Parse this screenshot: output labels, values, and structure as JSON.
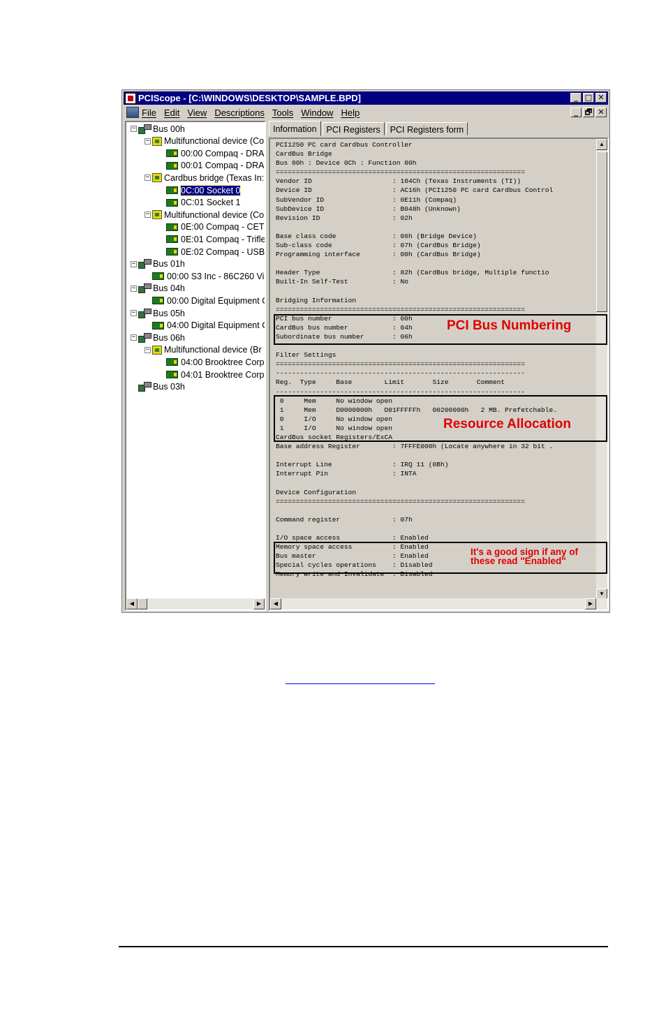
{
  "window": {
    "title": "PCIScope - [C:\\WINDOWS\\DESKTOP\\SAMPLE.BPD]",
    "title_buttons": [
      "_",
      "□",
      "✕"
    ],
    "mdi_buttons": [
      "_",
      "🗗",
      "✕"
    ]
  },
  "menu": {
    "items": [
      "File",
      "Edit",
      "View",
      "Descriptions",
      "Tools",
      "Window",
      "Help"
    ]
  },
  "tree": {
    "items": [
      {
        "label": "Bus 00h",
        "icon": "bus-icon",
        "level": 0
      },
      {
        "label": "Multifunctional device (Co",
        "icon": "multifunction-icon",
        "level": 1
      },
      {
        "label": "00:00 Compaq - DRA",
        "icon": "device-icon",
        "level": 2
      },
      {
        "label": "00:01 Compaq - DRA",
        "icon": "device-icon",
        "level": 2
      },
      {
        "label": "Cardbus bridge (Texas In:",
        "icon": "multifunction-icon",
        "level": 1
      },
      {
        "label": "0C:00 Socket 0",
        "icon": "device-icon",
        "level": 2,
        "selected": true
      },
      {
        "label": "0C:01 Socket 1",
        "icon": "device-icon",
        "level": 2
      },
      {
        "label": "Multifunctional device (Co",
        "icon": "multifunction-icon",
        "level": 1
      },
      {
        "label": "0E:00 Compaq - CET",
        "icon": "device-icon",
        "level": 2
      },
      {
        "label": "0E:01 Compaq - Trifle",
        "icon": "device-icon",
        "level": 2
      },
      {
        "label": "0E:02 Compaq - USB",
        "icon": "device-icon",
        "level": 2
      },
      {
        "label": "Bus 01h",
        "icon": "bus-icon",
        "level": 0
      },
      {
        "label": "00:00 S3 Inc - 86C260 Vi",
        "icon": "device-icon",
        "level": 1
      },
      {
        "label": "Bus 04h",
        "icon": "bus-icon",
        "level": 0
      },
      {
        "label": "00:00 Digital Equipment C",
        "icon": "device-icon",
        "level": 1
      },
      {
        "label": "Bus 05h",
        "icon": "bus-icon",
        "level": 0
      },
      {
        "label": "04:00 Digital Equipment C",
        "icon": "device-icon",
        "level": 1
      },
      {
        "label": "Bus 06h",
        "icon": "bus-icon",
        "level": 0
      },
      {
        "label": "Multifunctional device (Br",
        "icon": "multifunction-icon",
        "level": 1
      },
      {
        "label": "04:00 Brooktree Corp",
        "icon": "device-icon",
        "level": 2
      },
      {
        "label": "04:01 Brooktree Corp",
        "icon": "device-icon",
        "level": 2
      },
      {
        "label": "Bus 03h",
        "icon": "bus-icon",
        "level": 0
      }
    ]
  },
  "tabs": [
    "Information",
    "PCI Registers",
    "PCI Registers form"
  ],
  "info": {
    "lines": [
      "PCI1250 PC card Cardbus Controller",
      "CardBus Bridge",
      "Bus 00h : Device 0Ch : Function 00h",
      "==============================================================",
      "Vendor ID                    : 104Ch (Texas Instruments (TI))",
      "Device ID                    : AC16h (PCI1250 PC card Cardbus Control",
      "SubVendor ID                 : 0E11h (Compaq)",
      "SubDevice ID                 : B048h (Unknown)",
      "Revision ID                  : 02h",
      "",
      "Base class code              : 06h (Bridge Device)",
      "Sub-class code               : 07h (CardBus Bridge)",
      "Programming interface        : 00h (CardBus Bridge)",
      "",
      "Header Type                  : 82h (CardBus bridge, Multiple functio",
      "Built-In Self-Test           : No",
      "",
      "Bridging Information",
      "==============================================================",
      "PCI bus number               : 00h",
      "CardBus bus number           : 04h",
      "Subordinate bus number       : 06h",
      "",
      "Filter Settings",
      "==============================================================",
      "--------------------------------------------------------------",
      "Reg.  Type     Base        Limit       Size       Comment",
      "--------------------------------------------------------------",
      " 0     Mem     No window open",
      " 1     Mem     D0000000h   D01FFFFFh   00200000h   2 MB. Prefetchable.",
      " 0     I/O     No window open",
      " 1     I/O     No window open",
      "CardBus socket Registers/ExCA",
      "Base address Register        : 7FFFE000h (Locate anywhere in 32 bit .",
      "",
      "Interrupt Line               : IRQ 11 (0Bh)",
      "Interrupt Pin                : INTA",
      "",
      "Device Configuration",
      "==============================================================",
      "",
      "Command register             : 07h",
      "",
      "I/O space access             : Enabled",
      "Memory space access          : Enabled",
      "Bus master                   : Enabled",
      "Special cycles operations    : Disabled",
      "Memory write and Invalidate  : Disabled"
    ]
  },
  "annotations": {
    "bus_numbering": "PCI Bus Numbering",
    "resource_allocation": "Resource Allocation",
    "enabled_note_line1": "It's a good sign if any of",
    "enabled_note_line2": "these read \"Enabled\""
  },
  "colors": {
    "titlebar": "#000080",
    "annotation": "#e00000",
    "window_face": "#d4d0c8"
  }
}
